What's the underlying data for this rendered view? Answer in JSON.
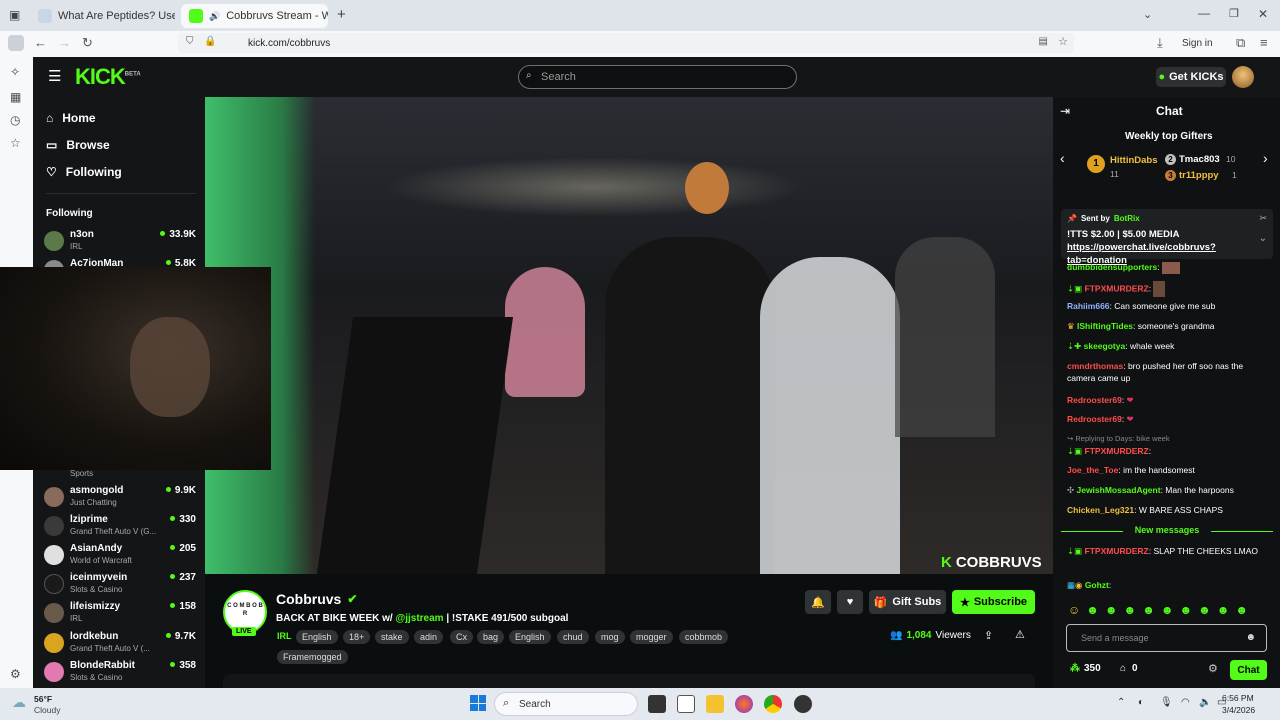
{
  "browser": {
    "tabs": [
      {
        "title": "What Are Peptides? Uses, Benef"
      },
      {
        "title": "Cobbruvs Stream - Watch L"
      }
    ],
    "url": "kick.com/cobbruvs",
    "sign_in": "Sign in"
  },
  "kick": {
    "logo": "KICK",
    "logo_badge": "BETA",
    "search_placeholder": "Search",
    "get_kicks": "Get KICKs",
    "nav": {
      "home": "Home",
      "browse": "Browse",
      "following": "Following"
    },
    "following_header": "Following",
    "following": [
      {
        "name": "n3on",
        "category": "IRL",
        "viewers": "33.9K",
        "color": "#5a7a4a"
      },
      {
        "name": "Ac7ionMan",
        "category": "",
        "viewers": "5.8K",
        "color": "#8a8a8a"
      },
      {
        "name": "",
        "category": "Sports",
        "viewers": "",
        "color": "#000000"
      },
      {
        "name": "asmongold",
        "category": "Just Chatting",
        "viewers": "9.9K",
        "color": "#8a6a5a"
      },
      {
        "name": "lziprime",
        "category": "Grand Theft Auto V (G...",
        "viewers": "330",
        "color": "#3a3a3a"
      },
      {
        "name": "AsianAndy",
        "category": "World of Warcraft",
        "viewers": "205",
        "color": "#e0e0e0"
      },
      {
        "name": "iceinmyvein",
        "category": "Slots & Casino",
        "viewers": "237",
        "color": "#1a1a1a"
      },
      {
        "name": "lifeismizzy",
        "category": "IRL",
        "viewers": "158",
        "color": "#6a5a4a"
      },
      {
        "name": "lordkebun",
        "category": "Grand Theft Auto V (...",
        "viewers": "9.7K",
        "color": "#d9a520"
      },
      {
        "name": "BlondeRabbit",
        "category": "Slots & Casino",
        "viewers": "358",
        "color": "#e07ab0"
      }
    ],
    "video_watermark": "COBBRUVS",
    "stream": {
      "avatar_text": "C O M B O B R",
      "live": "LIVE",
      "channel": "Cobbruvs",
      "title_a": "BACK AT BIKE WEEK w/ ",
      "title_mention": "@jjstream",
      "title_b": " | !STAKE 491/500 subgoal",
      "category": "IRL",
      "tags": [
        "English",
        "18+",
        "stake",
        "adin",
        "Cx",
        "bag",
        "English",
        "chud",
        "mog",
        "mogger",
        "cobbmob",
        "Framemogged"
      ],
      "viewers": "1,084",
      "viewers_label": "Viewers",
      "gift_subs": "Gift Subs",
      "subscribe": "Subscribe"
    },
    "chat": {
      "header": "Chat",
      "top_gifters_title": "Weekly top Gifters",
      "gifters": [
        {
          "rank": "1",
          "name": "HittinDabs",
          "count": "11"
        },
        {
          "rank": "2",
          "name": "Tmac803",
          "count": "10"
        },
        {
          "rank": "3",
          "name": "tr11pppy",
          "count": "1"
        }
      ],
      "pinned": {
        "sent_by": "Sent by",
        "bot": "BotRix",
        "text": "!TTS $2.00 | $5.00 MEDIA ",
        "link": "https://powerchat.live/cobbruvs?tab=donation"
      },
      "messages": [
        {
          "user": "dumbbidensupporters",
          "color": "#53fc18",
          "text": ""
        },
        {
          "user": "FTPXMURDERZ",
          "color": "#ff4d4d",
          "text": ""
        },
        {
          "user": "Rahiim666",
          "color": "#8fb3ff",
          "text": "Can someone give me sub"
        },
        {
          "user": "lShiftingTides",
          "color": "#53fc18",
          "text": "someone's grandma"
        },
        {
          "user": "skeegotya",
          "color": "#53fc18",
          "text": "whale week"
        },
        {
          "user": "cmndrthomas",
          "color": "#ff4d4d",
          "text": "bro pushed her off soo nas the camera came up"
        },
        {
          "user": "Redrooster69",
          "color": "#ff4d4d",
          "text": ""
        },
        {
          "user": "Redrooster69",
          "color": "#ff4d4d",
          "text": ""
        },
        {
          "user": "Replying to Days: bike week",
          "color": "#888888",
          "text": ""
        },
        {
          "user": "FTPXMURDERZ",
          "color": "#ff4d4d",
          "text": ""
        },
        {
          "user": "Joe_the_Toe",
          "color": "#ff4d4d",
          "text": "im the handsomest"
        },
        {
          "user": "JewishMossadAgent",
          "color": "#53fc18",
          "text": "Man the harpoons"
        },
        {
          "user": "Chicken_Leg321",
          "color": "#f0c040",
          "text": "W BARE ASS CHAPS"
        }
      ],
      "new_messages": "New messages",
      "after": [
        {
          "user": "FTPXMURDERZ",
          "color": "#ff4d4d",
          "text": "SLAP THE CHEEKS LMAO"
        },
        {
          "user": "Gohzt",
          "color": "#53fc18",
          "text": ""
        }
      ],
      "input_placeholder": "Send a message",
      "points": "350",
      "gifts": "0",
      "send": "Chat"
    }
  },
  "taskbar": {
    "weather_temp": "56°F",
    "weather_text": "Cloudy",
    "search": "Search",
    "time": "6:56 PM",
    "date": "3/4/2026"
  }
}
